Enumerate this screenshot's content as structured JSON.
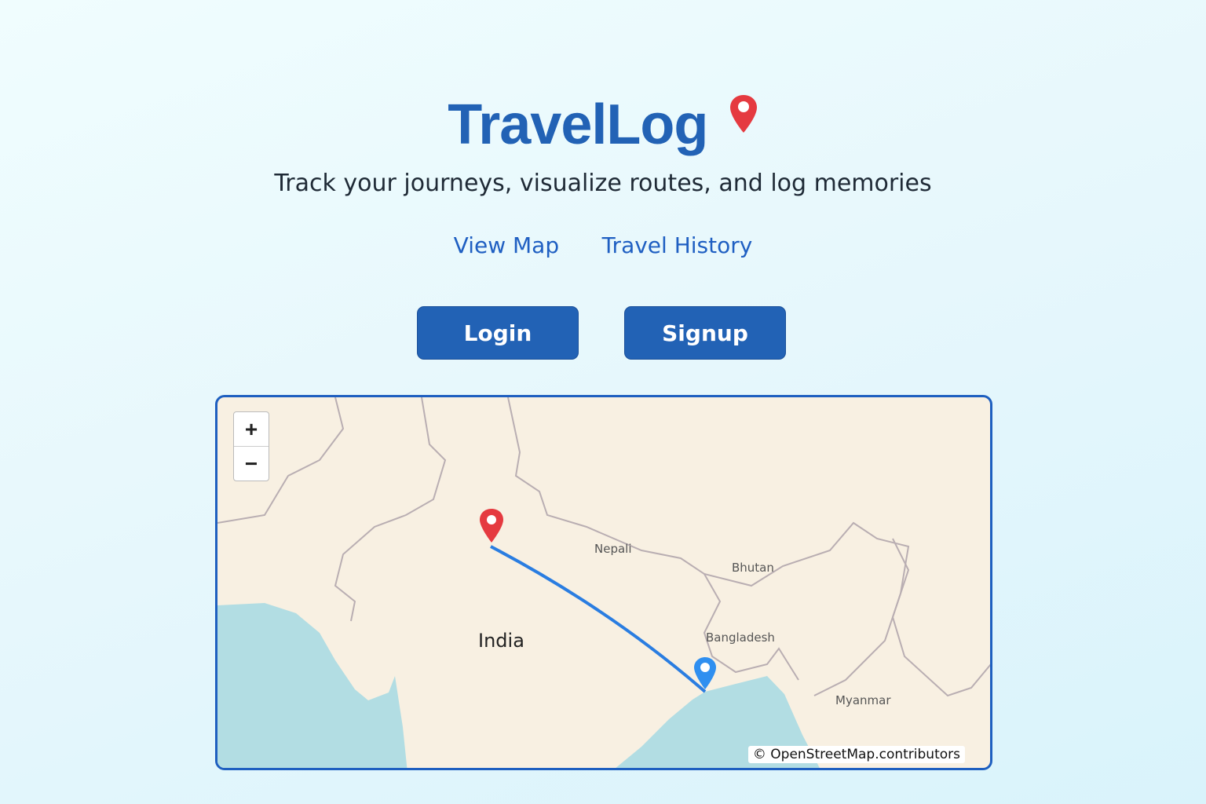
{
  "header": {
    "title": "TravelLog",
    "subtitle": "Track your journeys, visualize routes, and log memories",
    "logo_icon": "map-pin-icon",
    "pin_color": "#e53a40"
  },
  "nav": {
    "links": [
      {
        "label": "View Map"
      },
      {
        "label": "Travel History"
      }
    ]
  },
  "auth": {
    "login_label": "Login",
    "signup_label": "Signup"
  },
  "map": {
    "zoom_in": "+",
    "zoom_out": "−",
    "labels": {
      "nepal": "Nepali",
      "bhutan": "Bhutan",
      "bangladesh": "Bangladesh",
      "india": "India",
      "myanmar": "Myanmar"
    },
    "attribution": "© OpenStreetMap.contributors",
    "route": {
      "start_color": "#e53a40",
      "end_color": "#2f8ff0",
      "line_color": "#2a7de1"
    }
  }
}
